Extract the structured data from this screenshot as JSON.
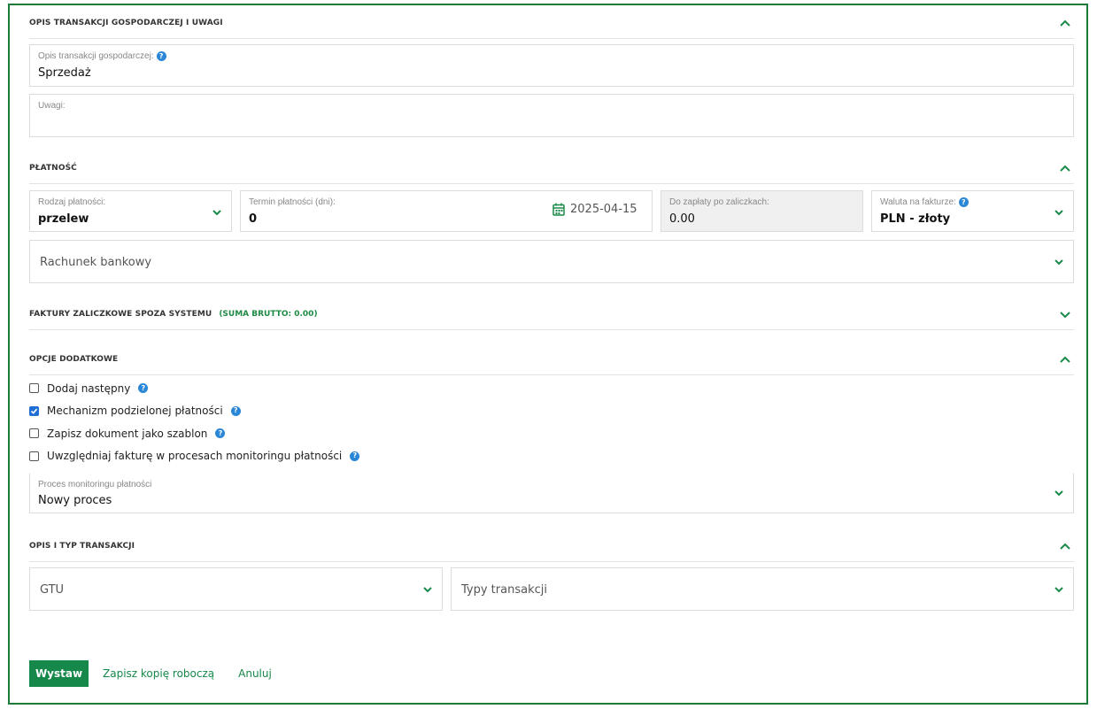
{
  "sections": {
    "opis": {
      "title": "OPIS TRANSAKCJI GOSPODARCZEJ I UWAGI",
      "fields": {
        "opis_label": "Opis transakcji gospodarczej:",
        "opis_value": "Sprzedaż",
        "uwagi_label": "Uwagi:",
        "uwagi_value": ""
      }
    },
    "platnosc": {
      "title": "PŁATNOŚĆ",
      "rodzaj_label": "Rodzaj płatności:",
      "rodzaj_value": "przelew",
      "termin_label": "Termin płatności (dni):",
      "termin_value": "0",
      "termin_date": "2025-04-15",
      "do_zaplaty_label": "Do zapłaty po zaliczkach:",
      "do_zaplaty_value": "0.00",
      "waluta_label": "Waluta na fakturze:",
      "waluta_value": "PLN - złoty",
      "rachunek_placeholder": "Rachunek bankowy"
    },
    "faktury": {
      "title": "FAKTURY ZALICZKOWE SPOZA SYSTEMU",
      "note": "(SUMA BRUTTO: 0.00)"
    },
    "opcje": {
      "title": "OPCJE DODATKOWE",
      "checkboxes": [
        {
          "label": "Dodaj następny",
          "checked": false
        },
        {
          "label": "Mechanizm podzielonej płatności",
          "checked": true
        },
        {
          "label": "Zapisz dokument jako szablon",
          "checked": false
        },
        {
          "label": "Uwzględniaj fakturę w procesach monitoringu płatności",
          "checked": false
        }
      ],
      "proces_label": "Proces monitoringu płatności",
      "proces_value": "Nowy proces"
    },
    "typ": {
      "title": "OPIS I TYP TRANSAKCJI",
      "gtu_placeholder": "GTU",
      "typy_placeholder": "Typy transakcji"
    }
  },
  "help_glyph": "?",
  "actions": {
    "wystaw": "Wystaw",
    "kopia": "Zapisz kopię roboczą",
    "anuluj": "Anuluj"
  },
  "colors": {
    "accent": "#15884a",
    "frame": "#1f7a3a",
    "help": "#2a86d6",
    "checkbox_on": "#1f6ed4"
  },
  "icons": {
    "section_toggle": "chevron-up-icon",
    "dropdown": "chevron-down-icon",
    "calendar": "calendar-icon",
    "help": "help-icon"
  }
}
